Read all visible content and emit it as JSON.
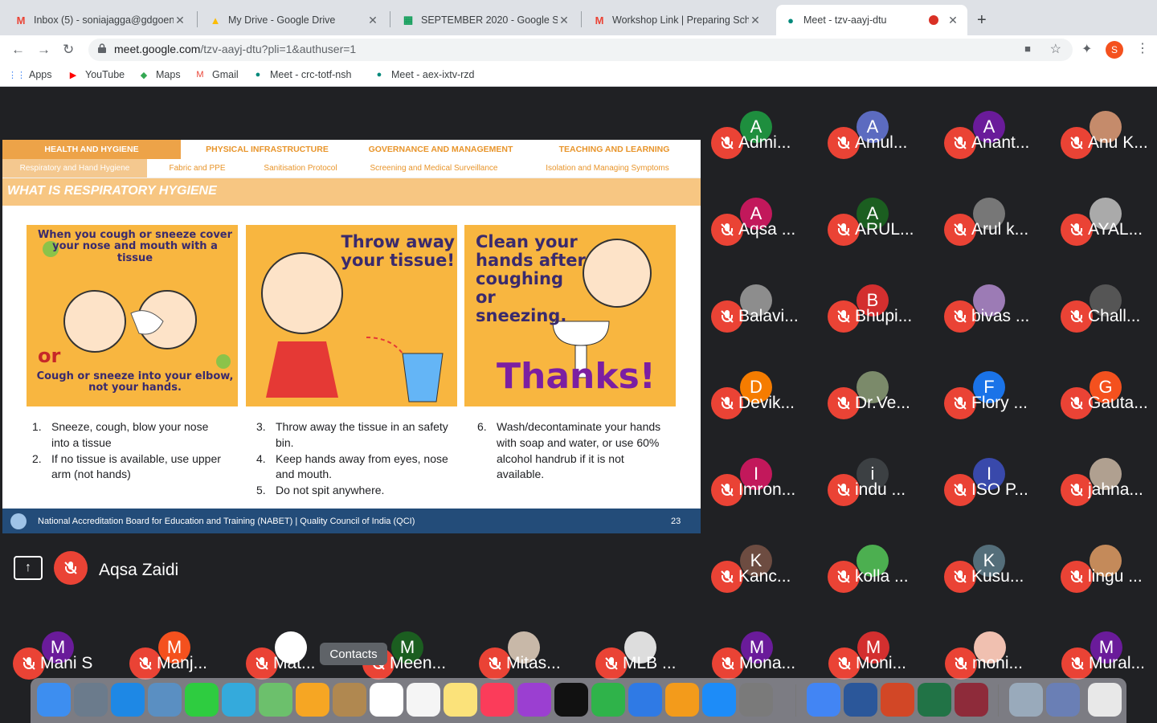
{
  "tabs": [
    {
      "title": "Inbox (5) - soniajagga@gdgoenka",
      "icon": "gmail-icon",
      "color": "#ea4335"
    },
    {
      "title": "My Drive - Google Drive",
      "icon": "drive-icon",
      "color": "#fbbc04"
    },
    {
      "title": "SEPTEMBER 2020 - Google Sheets",
      "icon": "sheets-icon",
      "color": "#0f9d58"
    },
    {
      "title": "Workshop Link | Preparing Schools",
      "icon": "gmail-icon",
      "color": "#ea4335"
    },
    {
      "title": "Meet - tzv-aayj-dtu",
      "icon": "meet-icon",
      "color": "#00897b"
    }
  ],
  "address": {
    "host": "meet.google.com",
    "path": "/tzv-aayj-dtu?pli=1&authuser=1"
  },
  "profile_initial": "S",
  "bookmarks": [
    "Apps",
    "YouTube",
    "Maps",
    "Gmail",
    "Meet - crc-totf-nsh",
    "Meet - aex-ixtv-rzd"
  ],
  "slide": {
    "tabs": [
      "HEALTH AND HYGIENE",
      "PHYSICAL INFRASTRUCTURE",
      "GOVERNANCE AND MANAGEMENT",
      "TEACHING AND LEARNING"
    ],
    "subtabs": [
      "Respiratory and Hand Hygiene",
      "Fabric and PPE",
      "Sanitisation Protocol",
      "Screening and Medical Surveillance",
      "Isolation and Managing Symptoms"
    ],
    "heading": "WHAT IS RESPIRATORY HYGIENE",
    "pic1_top": "When you cough or sneeze cover your nose and mouth with a tissue",
    "pic1_or": "or",
    "pic1_bottom": "Cough or sneeze into your elbow, not your hands.",
    "pic2_text": "Throw away your tissue!",
    "pic3_text": "Clean your hands after coughing or sneezing.",
    "pic3_thanks": "Thanks!",
    "list1": [
      {
        "n": "1.",
        "t": "Sneeze, cough, blow your nose into a tissue"
      },
      {
        "n": "2.",
        "t": "If no tissue is available, use upper arm (not hands)"
      }
    ],
    "list2": [
      {
        "n": "3.",
        "t": "Throw away the tissue in an safety bin."
      },
      {
        "n": "4.",
        "t": "Keep hands away from eyes, nose and mouth."
      },
      {
        "n": "5.",
        "t": "Do not spit anywhere."
      }
    ],
    "list3": [
      {
        "n": "6.",
        "t": "Wash/decontaminate your hands with soap and water, or use 60% alcohol handrub if it is not available."
      }
    ],
    "footer_text": "National Accreditation Board for Education and Training  (NABET)  |  Quality Council of India (QCI)",
    "page": "23"
  },
  "presenter": "Aqsa Zaidi",
  "participants": [
    {
      "name": "Admi...",
      "initial": "A",
      "color": "#1e8e3e"
    },
    {
      "name": "Amul...",
      "initial": "A",
      "color": "#5c6bc0"
    },
    {
      "name": "Anant...",
      "initial": "A",
      "color": "#6a1b9a"
    },
    {
      "name": "Anu K...",
      "initial": "",
      "color": "#c58b6b"
    },
    {
      "name": "Aqsa ...",
      "initial": "A",
      "color": "#c2185b"
    },
    {
      "name": "ARUL...",
      "initial": "A",
      "color": "#1b5e20"
    },
    {
      "name": "Arul k...",
      "initial": "",
      "color": "#777777"
    },
    {
      "name": "AYAL...",
      "initial": "",
      "color": "#aaaaaa"
    },
    {
      "name": "Balavi...",
      "initial": "",
      "color": "#8d8d8d"
    },
    {
      "name": "Bhupi...",
      "initial": "B",
      "color": "#d32f2f"
    },
    {
      "name": "bivas ...",
      "initial": "",
      "color": "#9c7bb5"
    },
    {
      "name": "Chall...",
      "initial": "",
      "color": "#555555"
    },
    {
      "name": "Devik...",
      "initial": "D",
      "color": "#f57c00"
    },
    {
      "name": "Dr.Ve...",
      "initial": "",
      "color": "#7b8a6a"
    },
    {
      "name": "Flory ...",
      "initial": "F",
      "color": "#1a73e8"
    },
    {
      "name": "Gauta...",
      "initial": "G",
      "color": "#f4511e"
    },
    {
      "name": "Imron...",
      "initial": "I",
      "color": "#c2185b"
    },
    {
      "name": "indu ...",
      "initial": "i",
      "color": "#3c4043"
    },
    {
      "name": "ISO P...",
      "initial": "I",
      "color": "#3949ab"
    },
    {
      "name": "jahna...",
      "initial": "",
      "color": "#b0a090"
    },
    {
      "name": "Kanc...",
      "initial": "K",
      "color": "#6d4c41"
    },
    {
      "name": "kolla ...",
      "initial": "",
      "color": "#4caf50"
    },
    {
      "name": "Kusu...",
      "initial": "K",
      "color": "#546e7a"
    },
    {
      "name": "lingu ...",
      "initial": "",
      "color": "#c48a5a"
    }
  ],
  "bottom_row": [
    {
      "name": "Mani S",
      "initial": "M",
      "color": "#6a1b9a"
    },
    {
      "name": "Manj...",
      "initial": "M",
      "color": "#f4511e"
    },
    {
      "name": "Mat...",
      "initial": "",
      "color": "#ffffff"
    },
    {
      "name": "Meen...",
      "initial": "M",
      "color": "#1b5e20"
    },
    {
      "name": "Mitas...",
      "initial": "",
      "color": "#c8b8a8"
    },
    {
      "name": "MLB ...",
      "initial": "",
      "color": "#dddddd"
    },
    {
      "name": "Mona...",
      "initial": "M",
      "color": "#6a1b9a"
    },
    {
      "name": "Moni...",
      "initial": "M",
      "color": "#d32f2f"
    },
    {
      "name": "moni...",
      "initial": "",
      "color": "#f0c0b0"
    },
    {
      "name": "Mural...",
      "initial": "M",
      "color": "#6a1b9a"
    }
  ],
  "tooltip": "Contacts",
  "dock": [
    {
      "name": "finder-icon",
      "color": "#3d8ef0"
    },
    {
      "name": "launchpad-icon",
      "color": "#6b7b8c"
    },
    {
      "name": "safari-icon",
      "color": "#1e88e5"
    },
    {
      "name": "preview-icon",
      "color": "#5a8fc2"
    },
    {
      "name": "facetime-icon",
      "color": "#2ecc40"
    },
    {
      "name": "messages-icon",
      "color": "#34aadc"
    },
    {
      "name": "maps-icon",
      "color": "#6cc06c"
    },
    {
      "name": "photos-icon",
      "color": "#f6a623"
    },
    {
      "name": "contacts-icon",
      "color": "#b08850"
    },
    {
      "name": "calendar-icon",
      "color": "#ffffff"
    },
    {
      "name": "reminders-icon",
      "color": "#f5f5f5"
    },
    {
      "name": "notes-icon",
      "color": "#fbe27a"
    },
    {
      "name": "music-icon",
      "color": "#fb3c5a"
    },
    {
      "name": "podcasts-icon",
      "color": "#9b3fd1"
    },
    {
      "name": "tv-icon",
      "color": "#111111"
    },
    {
      "name": "numbers-icon",
      "color": "#2fb34a"
    },
    {
      "name": "keynote-icon",
      "color": "#2f7ae5"
    },
    {
      "name": "pages-icon",
      "color": "#f39b1b"
    },
    {
      "name": "appstore-icon",
      "color": "#1d8cf8"
    },
    {
      "name": "system-preferences-icon",
      "color": "#7a7a7a"
    },
    {
      "name": "chrome-icon",
      "color": "#4285f4"
    },
    {
      "name": "word-icon",
      "color": "#2b579a"
    },
    {
      "name": "powerpoint-icon",
      "color": "#d24726"
    },
    {
      "name": "excel-icon",
      "color": "#217346"
    },
    {
      "name": "rar-icon",
      "color": "#8e2b3a"
    },
    {
      "name": "screenshot-folder-icon",
      "color": "#9ab"
    },
    {
      "name": "downloads-icon",
      "color": "#6a7fb5"
    },
    {
      "name": "trash-icon",
      "color": "#e8e8e8"
    }
  ]
}
